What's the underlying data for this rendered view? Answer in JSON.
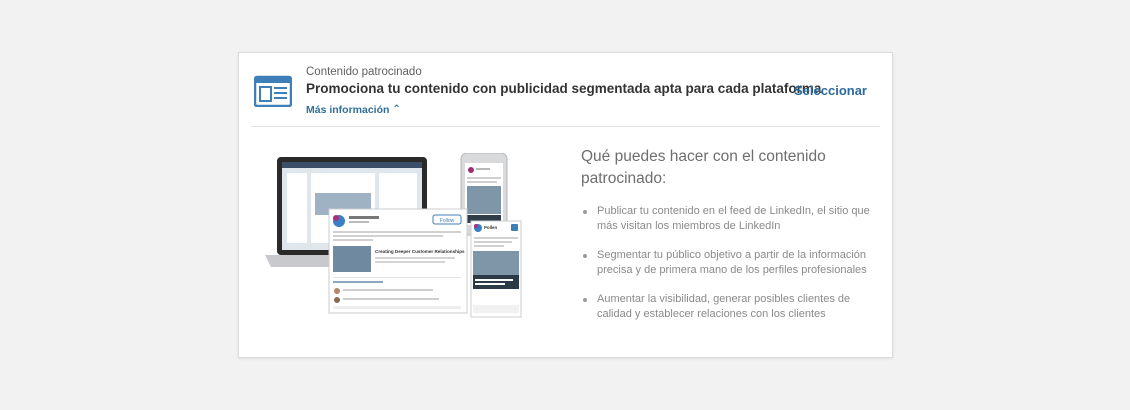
{
  "header": {
    "eyebrow": "Contenido patrocinado",
    "headline": "Promociona tu contenido con publicidad segmentada apta para cada plataforma",
    "more_link": "Más información",
    "more_icon": "chevron-up-icon",
    "select_label": "Seleccionar",
    "icon": "newspaper-icon"
  },
  "illustration": {
    "post_title": "Creating Deeper Customer Relationships",
    "follow_label": "Follow",
    "company_name": "Pollen",
    "phone_caption": "Creating Deeper Customer Relationships"
  },
  "content": {
    "question": "Qué puedes hacer con el contenido patrocinado:",
    "bullets": [
      "Publicar tu contenido en el feed de LinkedIn, el sitio que más visitan los miembros de LinkedIn",
      "Segmentar tu público objetivo a partir de la información precisa y de primera mano de los perfiles profesionales",
      "Aumentar la visibilidad, generar posibles clientes de calidad y establecer relaciones con los clientes"
    ]
  },
  "colors": {
    "accent": "#2b6a9c",
    "icon_blue": "#3f7fb8",
    "background": "#f2f2f3"
  }
}
